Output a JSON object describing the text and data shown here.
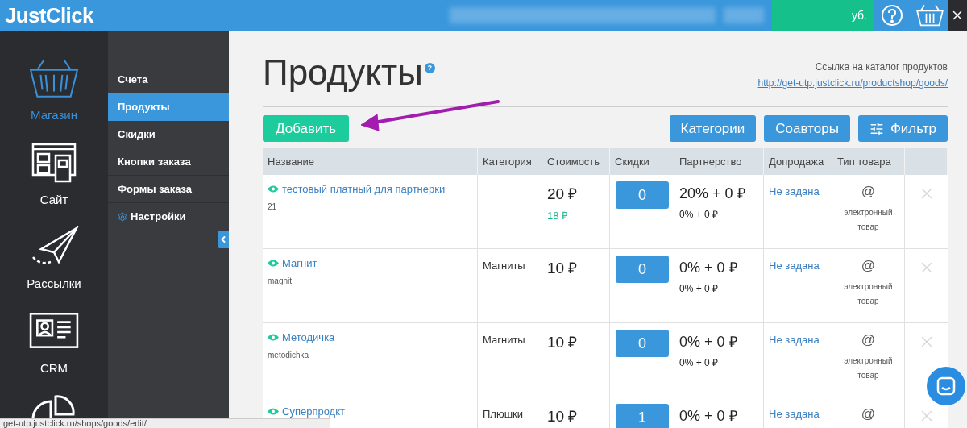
{
  "header": {
    "logo": "JustClick",
    "balance_suffix": "уб."
  },
  "rail": [
    {
      "label": "Магазин",
      "kind": "basket",
      "selected": true
    },
    {
      "label": "Сайт",
      "kind": "site",
      "selected": false
    },
    {
      "label": "Рассылки",
      "kind": "plane",
      "selected": false
    },
    {
      "label": "CRM",
      "kind": "crm",
      "selected": false
    },
    {
      "kind": "chart",
      "selected": false
    }
  ],
  "submenu": [
    {
      "label": "Счета",
      "selected": false,
      "kind": "plain"
    },
    {
      "label": "Продукты",
      "selected": true,
      "kind": "plain"
    },
    {
      "label": "Скидки",
      "selected": false,
      "kind": "plain"
    },
    {
      "label": "Кнопки заказа",
      "selected": false,
      "kind": "plain"
    },
    {
      "label": "Формы заказа",
      "selected": false,
      "kind": "plain"
    },
    {
      "label": "Настройки",
      "selected": false,
      "kind": "settings"
    }
  ],
  "page": {
    "title": "Продукты",
    "help": "?",
    "catalog_label": "Ссылка на каталог продуктов",
    "catalog_link": "http://get-utp.justclick.ru/productshop/goods/"
  },
  "toolbar": {
    "add": "Добавить",
    "buttons": [
      {
        "label": "Категории",
        "kind": "plain"
      },
      {
        "label": "Соавторы",
        "kind": "plain"
      },
      {
        "label": "Фильтр",
        "kind": "filter"
      }
    ]
  },
  "table": {
    "columns": [
      "Название",
      "Категория",
      "Стоимость",
      "Скидки",
      "Партнерство",
      "Допродажа",
      "Тип товара"
    ],
    "rows": [
      {
        "name": "тестовый платный для партнерки",
        "code": "21",
        "category": "",
        "price": "20 ₽",
        "sale_price": "18 ₽",
        "discounts": "0",
        "partner": "20% + 0 ₽",
        "partner_sub": "0% + 0 ₽",
        "upsell": "Не задана",
        "type_icon": "@",
        "type": "электронный товар"
      },
      {
        "name": "Магнит",
        "code": "magnit",
        "category": "Магниты",
        "price": "10 ₽",
        "discounts": "0",
        "partner": "0% + 0 ₽",
        "partner_sub": "0% + 0 ₽",
        "upsell": "Не задана",
        "type_icon": "@",
        "type": "электронный товар"
      },
      {
        "name": "Методичка",
        "code": "metodichka",
        "category": "Магниты",
        "price": "10 ₽",
        "discounts": "0",
        "partner": "0% + 0 ₽",
        "partner_sub": "0% + 0 ₽",
        "upsell": "Не задана",
        "type_icon": "@",
        "type": "электронный товар"
      },
      {
        "name": "Суперпродкт",
        "category": "Плюшки",
        "price": "10 ₽",
        "discounts": "1",
        "partner": "0% + 0 ₽",
        "upsell": "Не задана",
        "type_icon": "@"
      }
    ]
  },
  "status_bar": "get-utp.justclick.ru/shops/goods/edit/"
}
